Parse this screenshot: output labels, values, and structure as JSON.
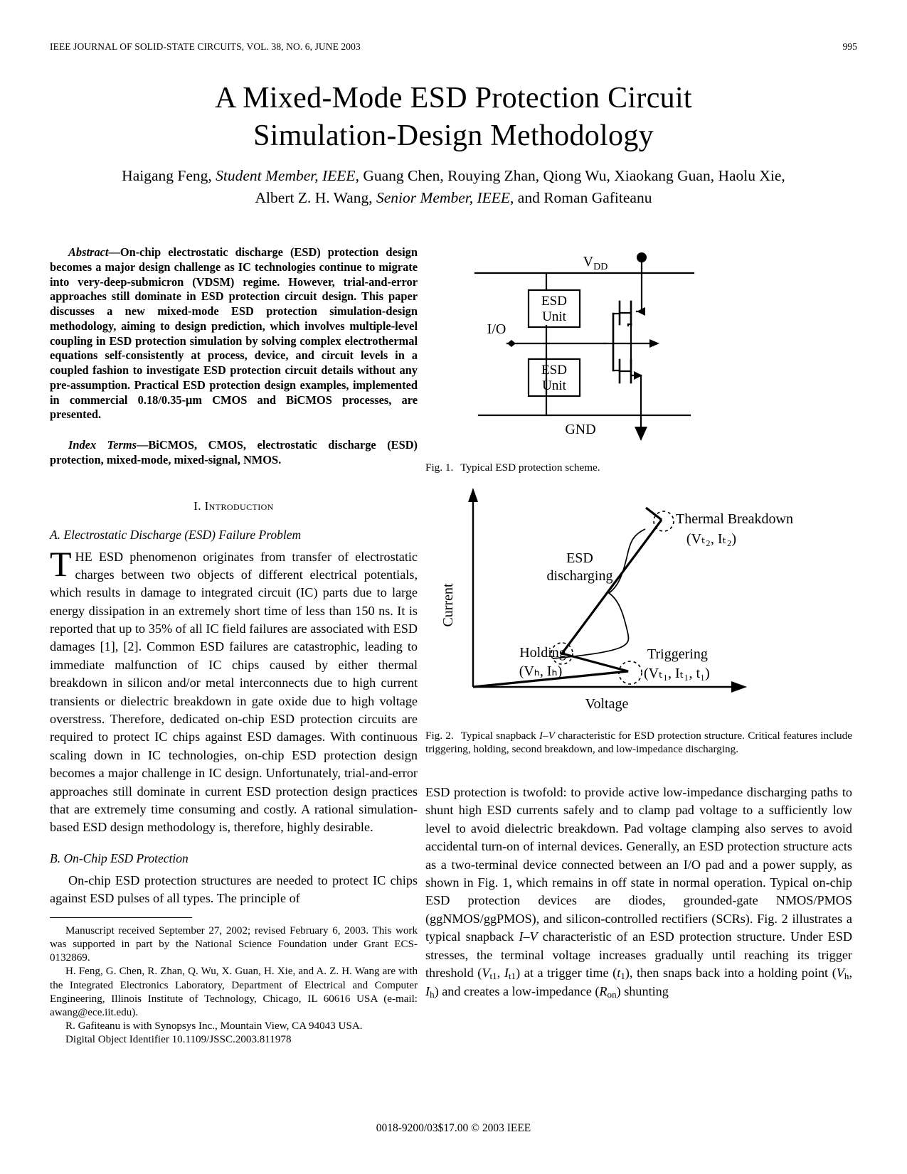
{
  "runhead": {
    "journal": "IEEE JOURNAL OF SOLID-STATE CIRCUITS, VOL. 38, NO. 6, JUNE 2003",
    "page_number": "995"
  },
  "title": {
    "line1": "A Mixed-Mode ESD Protection Circuit",
    "line2": "Simulation-Design Methodology"
  },
  "authors": {
    "line1_a": "Haigang Feng, ",
    "line1_b": "Student Member, IEEE",
    "line1_c": ", Guang Chen, Rouying Zhan, Qiong Wu, Xiaokang Guan, Haolu Xie,",
    "line2_a": "Albert Z. H. Wang, ",
    "line2_b": "Senior Member, IEEE",
    "line2_c": ", and Roman Gafiteanu"
  },
  "abstract": {
    "lead": "Abstract",
    "text": "—On-chip electrostatic discharge (ESD) protection design becomes a major design challenge as IC technologies continue to migrate into very-deep-submicron (VDSM) regime. However, trial-and-error approaches still dominate in ESD protection circuit design. This paper discusses a new mixed-mode ESD protection simulation-design methodology, aiming to design prediction, which involves multiple-level coupling in ESD protection simulation by solving complex electrothermal equations self-consistently at process, device, and circuit levels in a coupled fashion to investigate ESD protection circuit details without any pre-assumption. Practical ESD protection design examples, implemented in commercial 0.18/0.35-μm CMOS and BiCMOS processes, are presented."
  },
  "index_terms": {
    "lead": "Index Terms",
    "text": "—BiCMOS, CMOS, electrostatic discharge (ESD) protection, mixed-mode, mixed-signal, NMOS."
  },
  "sections": {
    "intro_heading": "I. Introduction",
    "sub_a_heading": "A.  Electrostatic Discharge (ESD) Failure Problem",
    "sub_b_heading": "B.  On-Chip ESD Protection",
    "para_a_dropcap": "T",
    "para_a_text": "HE ESD phenomenon originates from transfer of electrostatic charges between two objects of different electrical potentials, which results in damage to integrated circuit (IC) parts due to large energy dissipation in an extremely short time of less than 150 ns. It is reported that up to 35% of all IC field failures are associated with ESD damages [1], [2]. Common ESD failures are catastrophic, leading to immediate malfunction of IC chips caused by either thermal breakdown in silicon and/or metal interconnects due to high current transients or dielectric breakdown in gate oxide due to high voltage overstress. Therefore, dedicated on-chip ESD protection circuits are required to protect IC chips against ESD damages. With continuous scaling down in IC technologies, on-chip ESD protection design becomes a major challenge in IC design. Unfortunately, trial-and-error approaches still dominate in current ESD protection design practices that are extremely time consuming and costly. A rational simulation-based ESD design methodology is, therefore, highly desirable.",
    "para_b_text": "On-chip ESD protection structures are needed to protect IC chips against ESD pulses of all types. The principle of"
  },
  "footnote": {
    "p1": "Manuscript received September 27, 2002; revised February 6, 2003. This work was supported in part by the National Science Foundation under Grant ECS-0132869.",
    "p2": "H. Feng, G. Chen, R. Zhan, Q. Wu, X. Guan, H. Xie, and A. Z. H. Wang are with the Integrated Electronics Laboratory, Department of Electrical and Computer Engineering, Illinois Institute of Technology, Chicago, IL 60616 USA (e-mail: awang@ece.iit.edu).",
    "p3": "R. Gafiteanu is with Synopsys Inc., Mountain View, CA 94043 USA.",
    "p4": "Digital Object Identifier 10.1109/JSSC.2003.811978"
  },
  "page_footer": "0018-9200/03$17.00 © 2003 IEEE",
  "figures": {
    "fig1": {
      "caption_label": "Fig. 1.",
      "caption_text": "Typical ESD protection scheme.",
      "labels": {
        "vdd": "V",
        "vdd_sub": "DD",
        "gnd": "GND",
        "io": "I/O",
        "esd_unit_top_l1": "ESD",
        "esd_unit_top_l2": "Unit",
        "esd_unit_bot_l1": "ESD",
        "esd_unit_bot_l2": "Unit"
      }
    },
    "fig2": {
      "caption_label": "Fig. 2.",
      "caption_text_a": "Typical snapback ",
      "caption_italic": "I–V",
      "caption_text_b": " characteristic for ESD protection structure. Critical features include triggering, holding, second breakdown, and low-impedance discharging.",
      "labels": {
        "ylabel": "Current",
        "xlabel": "Voltage",
        "thermal_breakdown": "Thermal Breakdown",
        "thermal_breakdown_pt": "(Vₜ₂, Iₜ₂)",
        "esd_discharging_l1": "ESD",
        "esd_discharging_l2": "discharging",
        "holding": "Holding",
        "holding_pt": "(Vₕ, Iₕ)",
        "triggering": "Triggering",
        "triggering_pt": "(Vₜ₁, Iₜ₁, t₁)"
      }
    }
  },
  "right_column": {
    "para1_a": "ESD protection is twofold: to provide active low-impedance discharging paths to shunt high ESD currents safely and to clamp pad voltage to a sufficiently low level to avoid dielectric breakdown. Pad voltage clamping also serves to avoid accidental turn-on of internal devices. Generally, an ESD protection structure acts as a two-terminal device connected between an I/O pad and a power supply, as shown in Fig. 1, which remains in off state in normal operation. Typical on-chip ESD protection devices are diodes, grounded-gate NMOS/PMOS (ggNMOS/ggPMOS), and silicon-controlled rectifiers (SCRs). Fig. 2 illustrates a typical snapback ",
    "para1_iv": "I–V",
    "para1_b": " characteristic of an ESD protection structure. Under ESD stresses, the terminal voltage increases gradually until reaching its trigger threshold (",
    "para1_vt1": "V",
    "para1_vt1_sub": "t1",
    "para1_c": ", ",
    "para1_it1": "I",
    "para1_it1_sub": "t1",
    "para1_d": ") at a trigger time (",
    "para1_t1": "t",
    "para1_t1_sub": "1",
    "para1_e": "), then snaps back into a holding point (",
    "para1_vh": "V",
    "para1_vh_sub": "h",
    "para1_f": ", ",
    "para1_ih": "I",
    "para1_ih_sub": "h",
    "para1_g": ") and creates a low-impedance (",
    "para1_ron": "R",
    "para1_ron_sub": "on",
    "para1_h": ") shunting"
  },
  "chart_data": {
    "type": "line",
    "title": "Typical snapback I–V characteristic for ESD protection structure",
    "xlabel": "Voltage",
    "ylabel": "Current",
    "grid": false,
    "legend": "none",
    "axis_arrows": true,
    "annotations": [
      {
        "name": "Triggering",
        "point_label": "(Vt1, It1, t1)",
        "x": 0.72,
        "y": 0.07
      },
      {
        "name": "Holding",
        "point_label": "(Vh, Ih)",
        "x": 0.4,
        "y": 0.17
      },
      {
        "name": "Thermal Breakdown",
        "point_label": "(Vt2, It2)",
        "x": 0.76,
        "y": 0.87
      },
      {
        "name": "ESD discharging",
        "point_label": "",
        "x": 0.45,
        "y": 0.55
      }
    ],
    "series": [
      {
        "name": "snapback I-V curve",
        "points": [
          [
            0.0,
            0.0
          ],
          [
            0.72,
            0.07
          ],
          [
            0.4,
            0.17
          ],
          [
            0.76,
            0.87
          ]
        ]
      }
    ]
  }
}
